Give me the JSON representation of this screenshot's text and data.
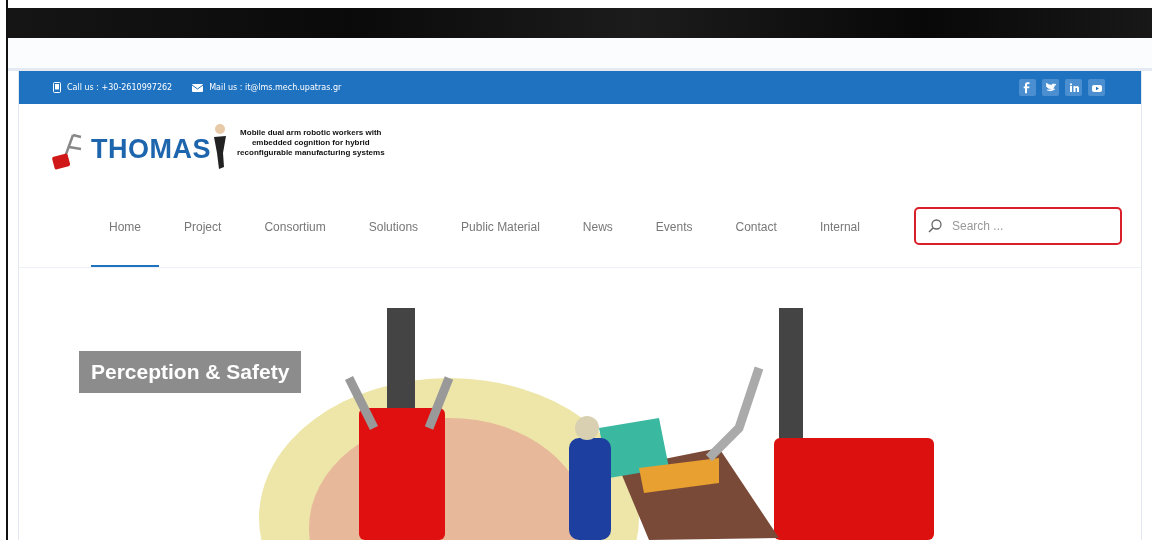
{
  "contact_bar": {
    "phone": "Call us : +30-2610997262",
    "mail": "Mail us : it@lms.mech.upatras.gr",
    "social": [
      {
        "kind": "facebook"
      },
      {
        "kind": "twitter"
      },
      {
        "kind": "linkedin"
      },
      {
        "kind": "youtube"
      }
    ]
  },
  "header": {
    "logo_text": "THOMAS",
    "tagline": "Mobile dual arm robotic workers with\nembedded cognition for hybrid\nreconfigurable manufacturing systems"
  },
  "nav": [
    {
      "label": "Home",
      "selected": true
    },
    {
      "label": "Project",
      "selected": false
    },
    {
      "label": "Consortium",
      "selected": false
    },
    {
      "label": "Solutions",
      "selected": false
    },
    {
      "label": "Public Material",
      "selected": false
    },
    {
      "label": "News",
      "selected": false
    },
    {
      "label": "Events",
      "selected": false
    },
    {
      "label": "Contact",
      "selected": false
    },
    {
      "label": "Internal",
      "selected": false
    }
  ],
  "search": {
    "placeholder": "Search ..."
  },
  "hero": {
    "kind": "picture",
    "caption": "Perception & Safety"
  }
}
